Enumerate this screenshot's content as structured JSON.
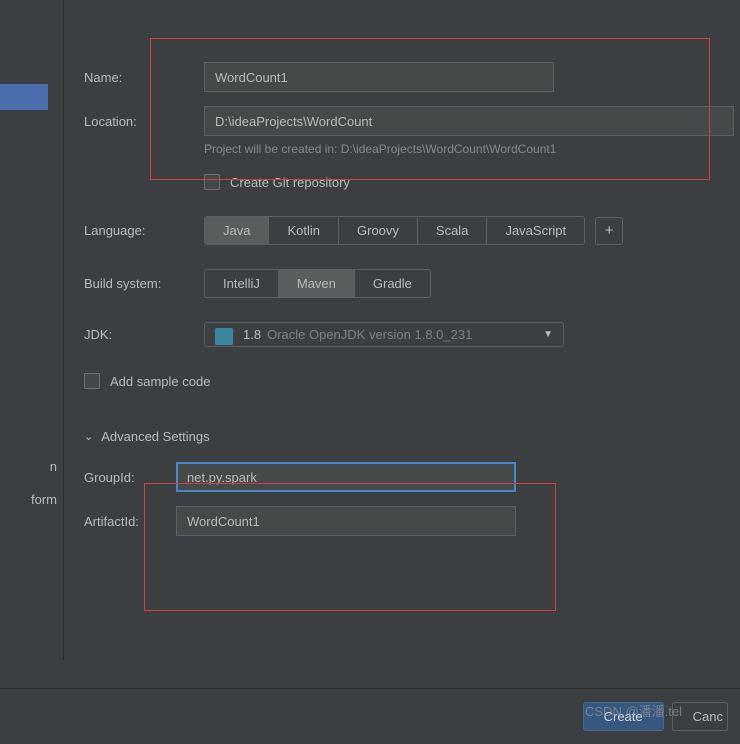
{
  "sidebar": {
    "partial_items": [
      "n",
      "form"
    ]
  },
  "form": {
    "name_label": "Name:",
    "name_value": "WordCount1",
    "location_label": "Location:",
    "location_value": "D:\\ideaProjects\\WordCount",
    "location_hint": "Project will be created in: D:\\ideaProjects\\WordCount\\WordCount1",
    "git_checkbox_label": "Create Git repository",
    "language_label": "Language:",
    "language_options": [
      "Java",
      "Kotlin",
      "Groovy",
      "Scala",
      "JavaScript"
    ],
    "language_selected": "Java",
    "plus_label": "+",
    "build_label": "Build system:",
    "build_options": [
      "IntelliJ",
      "Maven",
      "Gradle"
    ],
    "build_selected": "Maven",
    "jdk_label": "JDK:",
    "jdk_version": "1.8",
    "jdk_detail": "Oracle OpenJDK version 1.8.0_231",
    "sample_checkbox_label": "Add sample code"
  },
  "advanced": {
    "header": "Advanced Settings",
    "groupid_label": "GroupId:",
    "groupid_value": "net.py.spark",
    "artifactid_label": "ArtifactId:",
    "artifactid_value": "WordCount1"
  },
  "footer": {
    "create_label": "Create",
    "cancel_label": "Canc"
  },
  "watermark": "CSDN @潘潘.tel"
}
